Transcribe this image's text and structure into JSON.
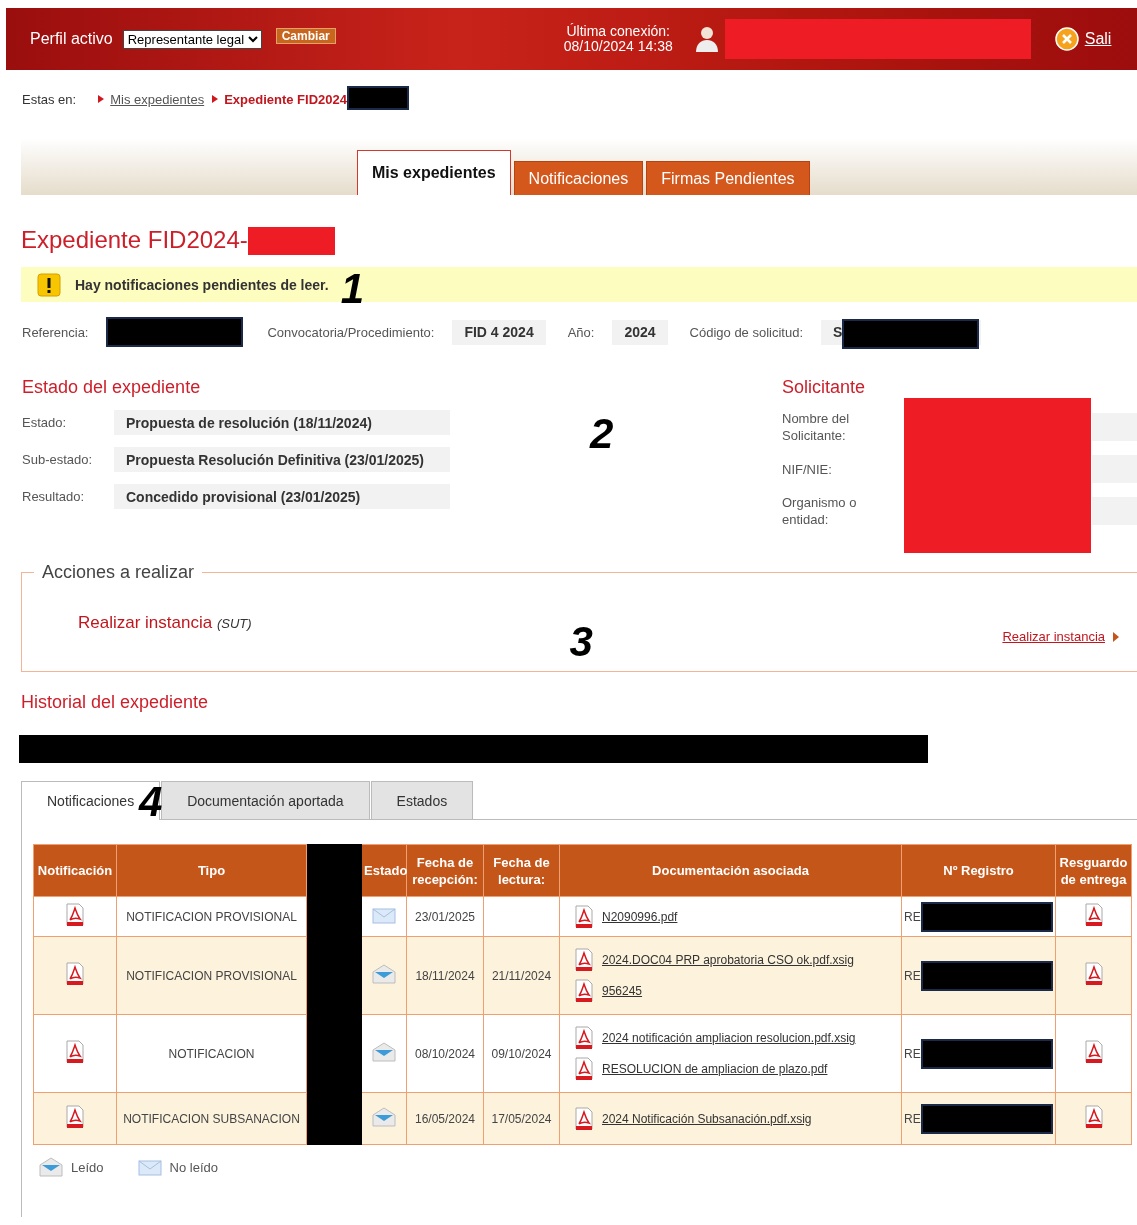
{
  "header": {
    "profile_label": "Perfil activo",
    "profile_select": "Representante legal",
    "change_button": "Cambiar",
    "last_connection_label": "Última conexión:",
    "last_connection_time": "08/10/2024 14:38",
    "logout": "Sali"
  },
  "breadcrumb": {
    "label": "Estas en:",
    "items": [
      {
        "text": "Mis expedientes",
        "current": false
      },
      {
        "text": "Expediente FID2024",
        "current": true
      }
    ]
  },
  "main_tabs": [
    {
      "label": "Mis expedientes",
      "selected": true
    },
    {
      "label": "Notificaciones",
      "selected": false
    },
    {
      "label": "Firmas Pendientes",
      "selected": false
    }
  ],
  "page_title": "Expediente FID2024-",
  "alert": {
    "text": "Hay notificaciones pendientes de leer.",
    "annotation": "1"
  },
  "summary": [
    {
      "label": "Referencia:",
      "redacted": true
    },
    {
      "label": "Convocatoria/Procedimiento:",
      "value": "FID 4 2024",
      "redacted": false
    },
    {
      "label": "Año:",
      "value": "2024",
      "redacted": false
    },
    {
      "label": "Código de solicitud:",
      "value": "S",
      "redacted": true
    }
  ],
  "estado": {
    "title": "Estado del expediente",
    "annotation": "2",
    "fields": [
      {
        "label": "Estado:",
        "value": "Propuesta de resolución (18/11/2024)"
      },
      {
        "label": "Sub-estado:",
        "value": "Propuesta Resolución Definitiva (23/01/2025)"
      },
      {
        "label": "Resultado:",
        "value": "Concedido provisional (23/01/2025)"
      }
    ]
  },
  "solicitante": {
    "title": "Solicitante",
    "fields": [
      {
        "label": "Nombre del Solicitante:"
      },
      {
        "label": "NIF/NIE:"
      },
      {
        "label": "Organismo o entidad:"
      }
    ]
  },
  "acciones": {
    "legend": "Acciones a realizar",
    "action": "Realizar instancia",
    "action_note": "(SUT)",
    "annotation": "3",
    "link": "Realizar instancia"
  },
  "historial": {
    "title": "Historial del expediente",
    "annotation": "4",
    "tabs": [
      {
        "label": "Notificaciones",
        "selected": true
      },
      {
        "label": "Documentación aportada",
        "selected": false
      },
      {
        "label": "Estados",
        "selected": false
      }
    ],
    "table": {
      "columns": [
        {
          "label": "Notificación"
        },
        {
          "label": "Tipo"
        },
        {
          "redacted": true
        },
        {
          "label": "Estado"
        },
        {
          "label": "Fecha de recepción:"
        },
        {
          "label": "Fecha de lectura:"
        },
        {
          "label": "Documentación asociada"
        },
        {
          "label": "Nº Registro"
        },
        {
          "label": "Resguardo de entrega"
        }
      ],
      "rows": [
        {
          "tipo": "NOTIFICACION PROVISIONAL",
          "read": false,
          "fecha_recepcion": "23/01/2025",
          "documents": [
            "N2090996.pdf"
          ],
          "registro": "RE"
        },
        {
          "tipo": "NOTIFICACION PROVISIONAL",
          "read": true,
          "fecha_recepcion": "18/11/2024",
          "fecha_lectura": "21/11/2024",
          "documents": [
            "2024.DOC04  PRP aprobatoria CSO ok.pdf.xsig",
            "956245"
          ],
          "registro": "RE"
        },
        {
          "tipo": "NOTIFICACION",
          "read": true,
          "fecha_recepcion": "08/10/2024",
          "fecha_lectura": "09/10/2024",
          "documents": [
            "2024 notificación ampliacion resolucion.pdf.xsig",
            "RESOLUCION de ampliacion de plazo.pdf"
          ],
          "registro": "RE"
        },
        {
          "tipo": "NOTIFICACION SUBSANACION",
          "read": true,
          "fecha_recepcion": "16/05/2024",
          "fecha_lectura": "17/05/2024",
          "documents": [
            "2024 Notificación Subsanación.pdf.xsig"
          ],
          "registro": "RE"
        }
      ]
    },
    "legend": [
      {
        "label": "Leído",
        "read": true
      },
      {
        "label": "No leído",
        "read": false
      }
    ]
  }
}
